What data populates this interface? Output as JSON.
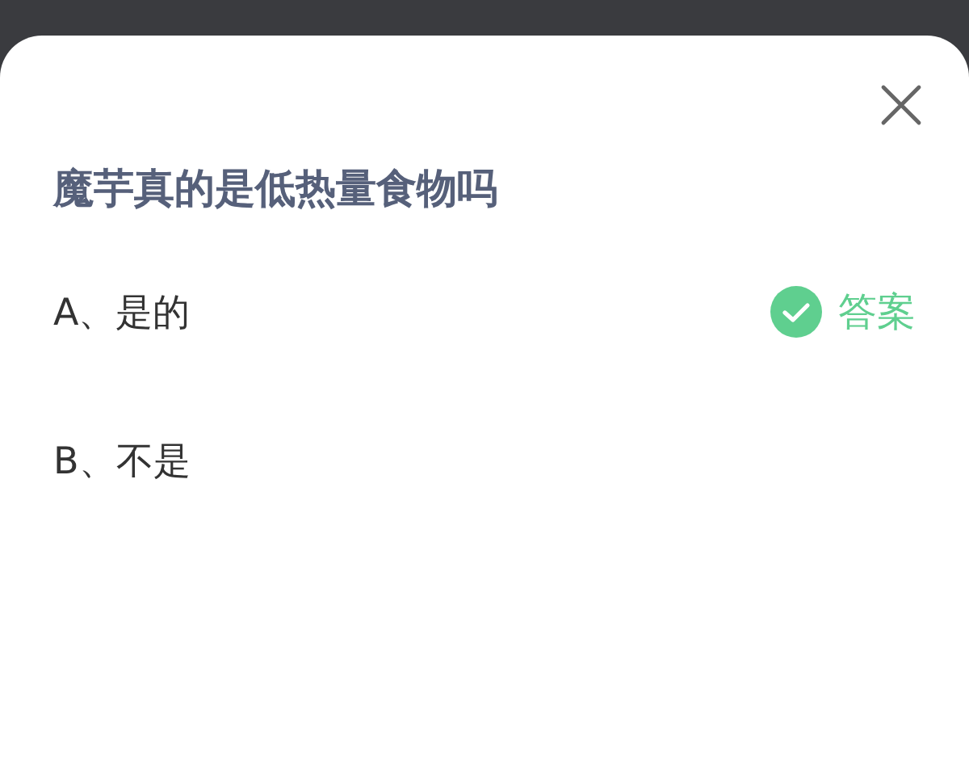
{
  "question": "魔芋真的是低热量食物吗",
  "options": [
    {
      "label": "A、是的",
      "correct": true,
      "answer_label": "答案"
    },
    {
      "label": "B、不是",
      "correct": false
    }
  ]
}
